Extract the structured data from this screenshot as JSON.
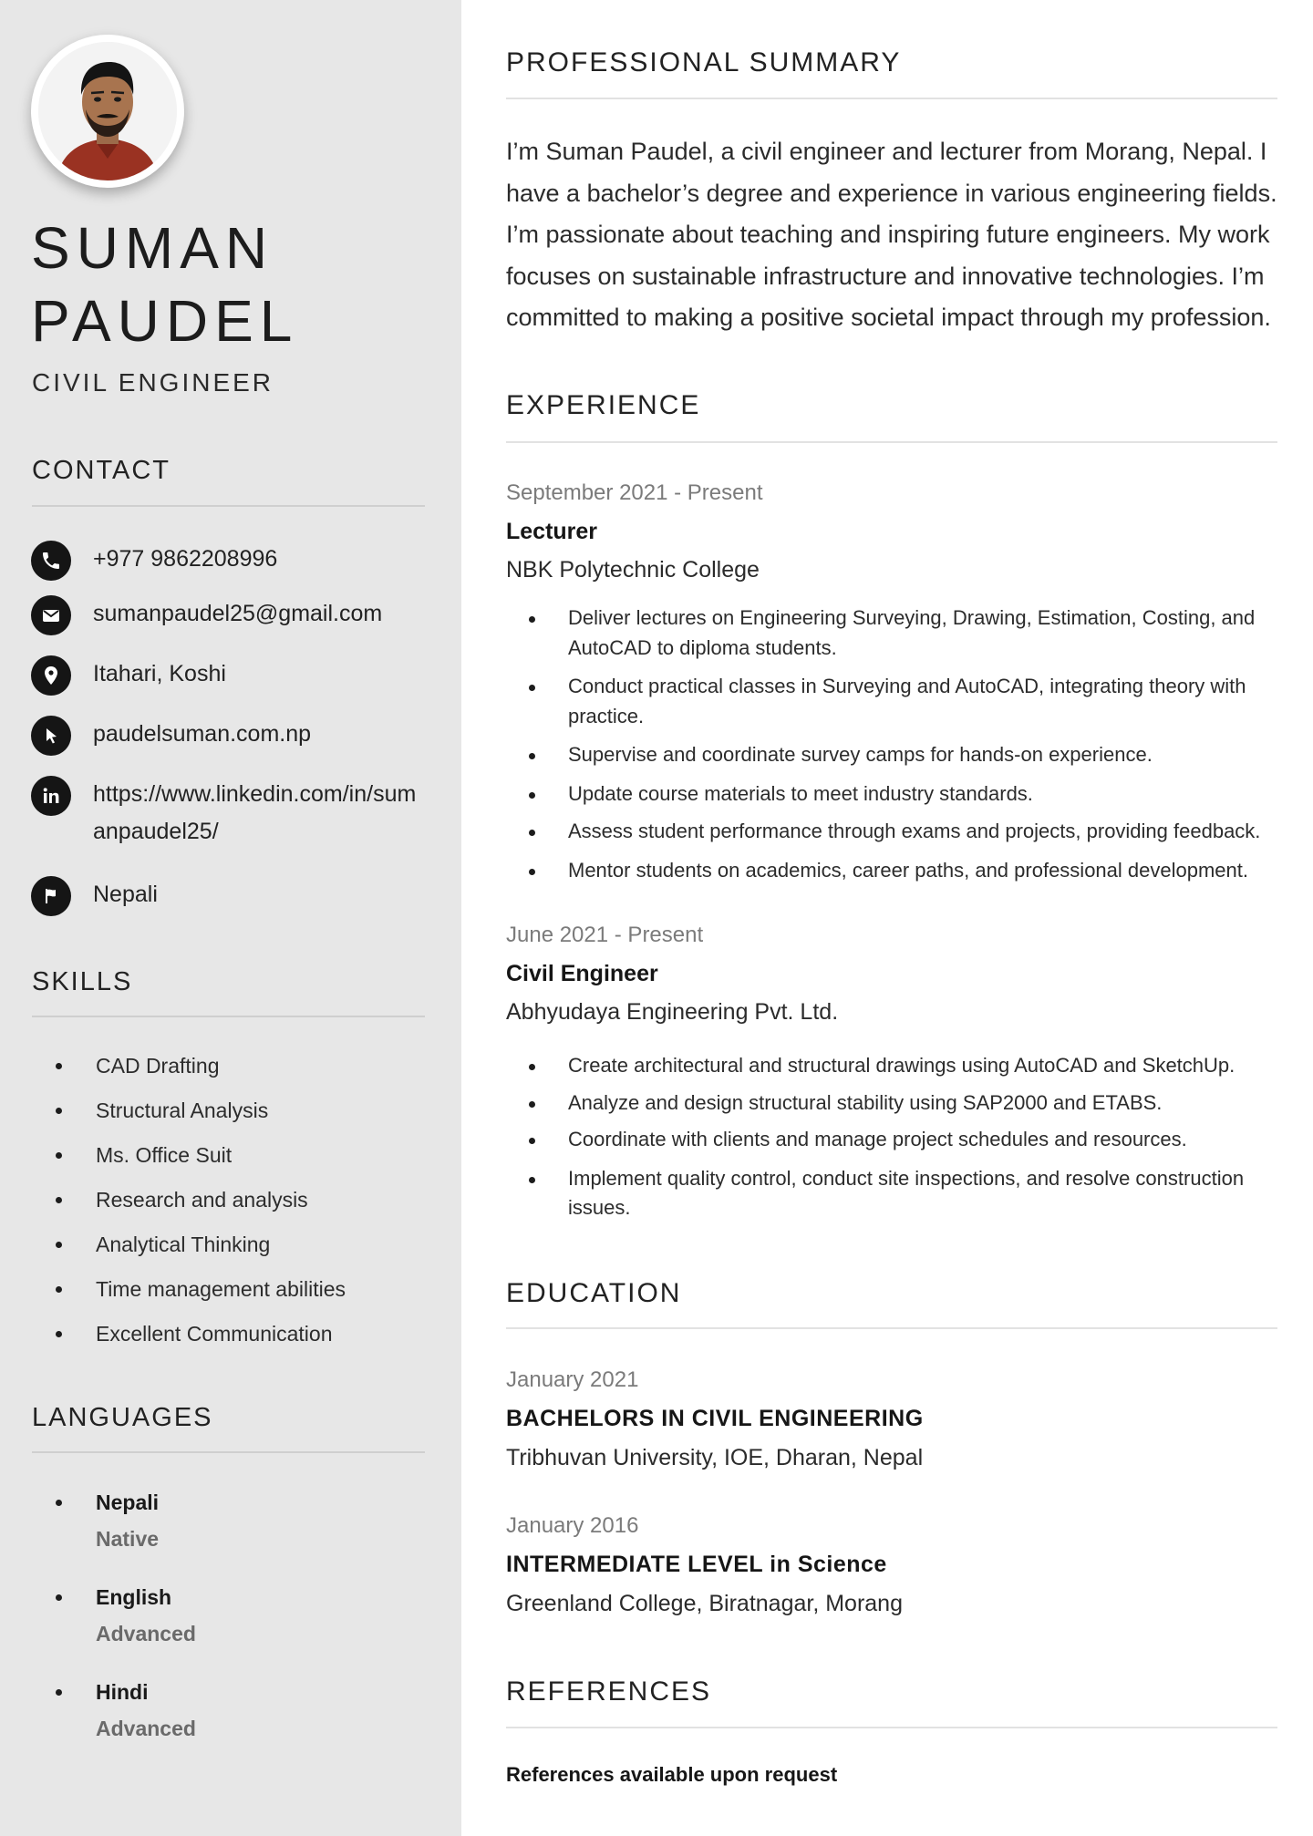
{
  "profile": {
    "name_line1": "SUMAN",
    "name_line2": "PAUDEL",
    "role": "CIVIL ENGINEER"
  },
  "contact": {
    "heading": "CONTACT",
    "phone": "+977 9862208996",
    "email": "sumanpaudel25@gmail.com",
    "location": "Itahari, Koshi",
    "website": "paudelsuman.com.np",
    "linkedin": "https://www.linkedin.com/in/sumanpaudel25/",
    "nationality": "Nepali"
  },
  "skills": {
    "heading": "SKILLS",
    "items": [
      "CAD Drafting",
      "Structural Analysis",
      "Ms. Office Suit",
      "Research and analysis",
      "Analytical Thinking",
      "Time management abilities",
      "Excellent Communication"
    ]
  },
  "languages": {
    "heading": "LANGUAGES",
    "items": [
      {
        "name": "Nepali",
        "level": "Native"
      },
      {
        "name": "English",
        "level": "Advanced"
      },
      {
        "name": "Hindi",
        "level": "Advanced"
      }
    ]
  },
  "summary": {
    "heading": "PROFESSIONAL SUMMARY",
    "text": "I’m Suman Paudel, a civil engineer and lecturer from Morang, Nepal. I have a bachelor’s degree and experience in various engineering fields. I’m passionate about teaching and inspiring future engineers. My work focuses on sustainable infrastructure and innovative technologies. I’m committed to making a positive societal impact through my profession."
  },
  "experience": {
    "heading": "EXPERIENCE",
    "jobs": [
      {
        "date": "September 2021 - Present",
        "title": "Lecturer",
        "company": "NBK Polytechnic College",
        "bullets": [
          "Deliver lectures on Engineering Surveying, Drawing, Estimation, Costing, and AutoCAD to diploma students.",
          "Conduct practical classes in Surveying and AutoCAD, integrating theory with practice.",
          "Supervise and coordinate survey camps for hands-on experience.",
          "Update course materials to meet industry standards.",
          "Assess student performance through exams and projects, providing feedback.",
          "Mentor students on academics, career paths, and professional development."
        ]
      },
      {
        "date": "June 2021 - Present",
        "title": "Civil Engineer",
        "company": "Abhyudaya Engineering Pvt. Ltd.",
        "bullets": [
          "Create architectural and structural drawings using AutoCAD and SketchUp.",
          "Analyze and design structural stability using SAP2000 and ETABS.",
          "Coordinate with clients and manage project schedules and resources.",
          "Implement quality control, conduct site inspections, and resolve construction issues."
        ]
      }
    ]
  },
  "education": {
    "heading": "EDUCATION",
    "items": [
      {
        "date": "January 2021",
        "title": "BACHELORS IN CIVIL ENGINEERING",
        "school": "Tribhuvan University, IOE, Dharan, Nepal"
      },
      {
        "date": "January 2016",
        "title": "INTERMEDIATE LEVEL in Science",
        "school": "Greenland College, Biratnagar, Morang"
      }
    ]
  },
  "references": {
    "heading": "REFERENCES",
    "text": "References available upon request"
  },
  "colors": {
    "sidebar_bg": "#e7e7e7",
    "icon_bg": "#151515",
    "date_gray": "#7b7b7b",
    "rule_gray": "#e2e2e2"
  },
  "icons": [
    "phone-icon",
    "email-icon",
    "location-icon",
    "cursor-icon",
    "linkedin-icon",
    "flag-icon"
  ]
}
